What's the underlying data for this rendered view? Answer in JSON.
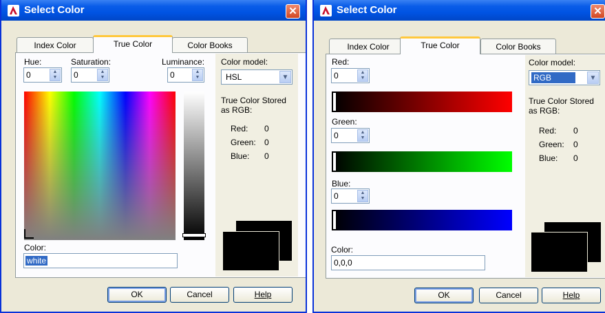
{
  "left": {
    "title": "Select Color",
    "close": "✕",
    "tabs": [
      "Index Color",
      "True Color",
      "Color Books"
    ],
    "hue_label": "Hue:",
    "hue_value": "0",
    "saturation_label": "Saturation:",
    "saturation_value": "0",
    "luminance_label": "Luminance:",
    "luminance_value": "0",
    "color_model_label": "Color model:",
    "color_model_value": "HSL",
    "stored_label": "True Color Stored as RGB:",
    "red_label": "Red:",
    "red_value": "0",
    "green_label": "Green:",
    "green_value": "0",
    "blue_label": "Blue:",
    "blue_value": "0",
    "color_label": "Color:",
    "color_value": "white",
    "ok": "OK",
    "cancel": "Cancel",
    "help": "Help"
  },
  "right": {
    "title": "Select Color",
    "close": "✕",
    "tabs": [
      "Index Color",
      "True Color",
      "Color Books"
    ],
    "red_label": "Red:",
    "red_value": "0",
    "green_label": "Green:",
    "green_value": "0",
    "blue_label": "Blue:",
    "blue_value": "0",
    "color_model_label": "Color model:",
    "color_model_value": "RGB",
    "stored_label": "True Color Stored as RGB:",
    "info_red_label": "Red:",
    "info_red_value": "0",
    "info_green_label": "Green:",
    "info_green_value": "0",
    "info_blue_label": "Blue:",
    "info_blue_value": "0",
    "color_label": "Color:",
    "color_value": "0,0,0",
    "ok": "OK",
    "cancel": "Cancel",
    "help": "Help"
  },
  "colors": {
    "title_bar": "#0054e3",
    "dialog_bg": "#ece9d8",
    "panel_bg": "#fcfcfe",
    "selection": "#316ac5"
  },
  "icons": {
    "app": "autocad-icon",
    "close": "close-icon",
    "spin": "spin-arrows-icon",
    "combo": "chevron-down-icon"
  }
}
